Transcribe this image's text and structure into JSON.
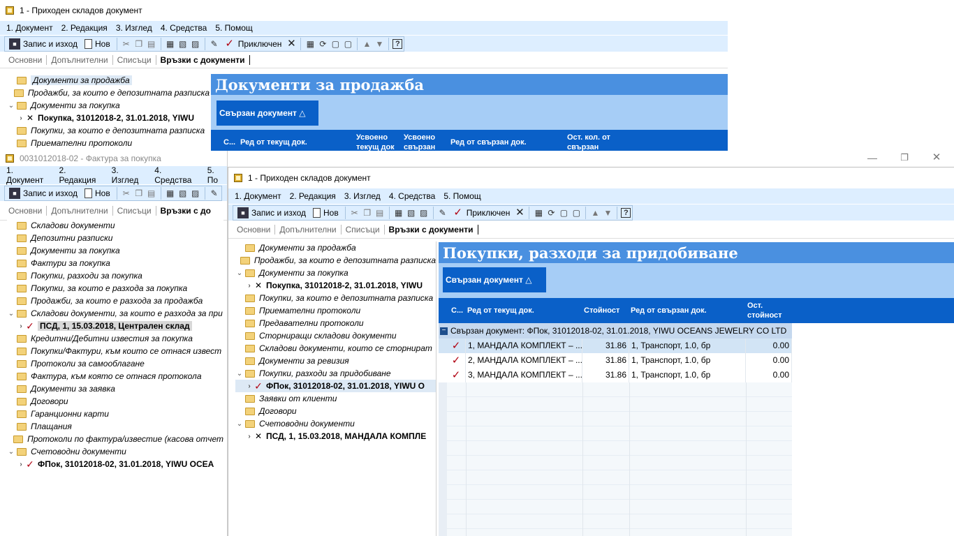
{
  "colors": {
    "menu_bg": "#ddeeff",
    "header_blue": "#4a90e0",
    "grid_head": "#0a60c8",
    "group_area": "#a6cdf6",
    "check_red": "#b00010"
  },
  "back_window": {
    "title": "1 - Приходен складов документ",
    "menu": [
      "1. Документ",
      "2. Редакция",
      "3. Изглед",
      "4. Средства",
      "5. Помощ"
    ],
    "toolbar": {
      "save": "Запис и изход",
      "new": "Нов",
      "closed": "Приключен"
    },
    "tabs": [
      "Основни",
      "Допълнителни",
      "Списъци",
      "Връзки с документи"
    ],
    "tree": [
      "Документи за продажба",
      "Продажби, за които е депозитната разписка",
      "Документи за покупка",
      "Покупка, 31012018-2, 31.01.2018, YIWU",
      "Покупки, за които е депозитната разписка",
      "Приемателни протоколи"
    ],
    "panel_title": "Документи за продажба",
    "group_button": "Свързан документ △",
    "columns": [
      "С...",
      "Ред от текущ док.",
      "Усвоено текущ док",
      "Усвоено свързан",
      "Ред от свързан док.",
      "Ост. кол. от свързан"
    ]
  },
  "middle_window": {
    "title": "0031012018-02 - Фактура за покупка",
    "menu": [
      "1. Документ",
      "2. Редакция",
      "3. Изглед",
      "4. Средства",
      "5. По"
    ],
    "toolbar": {
      "save": "Запис и изход",
      "new": "Нов"
    },
    "tabs": [
      "Основни",
      "Допълнителни",
      "Списъци",
      "Връзки с до"
    ],
    "tree": [
      "Складови документи",
      "Депозитни разписки",
      "Документи за покупка",
      "Фактури за покупка",
      "Покупки, разходи за покупка",
      "Покупки, за които е разхода за покупка",
      "Продажби, за които е разхода за продажба",
      "Складови документи, за които е разхода за при",
      "ПСД, 1, 15.03.2018, Централен склад",
      "Кредитни/Дебитни известия за покупка",
      "Покупки/Фактури, към които се отнася извест",
      "Протоколи за самооблагане",
      "Фактура, към която се отнася протокола",
      "Документи за заявка",
      "Договори",
      "Гаранционни карти",
      "Плащания",
      "Протоколи по фактура/известие (касова отчет",
      "Счетоводни документи",
      "ФПок, 31012018-02, 31.01.2018, YIWU OCEA"
    ]
  },
  "front_window": {
    "title": "1 - Приходен складов документ",
    "menu": [
      "1. Документ",
      "2. Редакция",
      "3. Изглед",
      "4. Средства",
      "5. Помощ"
    ],
    "toolbar": {
      "save": "Запис и изход",
      "new": "Нов",
      "closed": "Приключен"
    },
    "tabs": [
      "Основни",
      "Допълнителни",
      "Списъци",
      "Връзки с документи"
    ],
    "tree": [
      "Документи за продажба",
      "Продажби, за които е депозитната разписка",
      "Документи за покупка",
      "Покупка, 31012018-2, 31.01.2018, YIWU",
      "Покупки, за които е депозитната разписка",
      "Приемателни протоколи",
      "Предавателни протоколи",
      "Сторниращи складови документи",
      "Складови документи, които се сторнират",
      "Документи за ревизия",
      "Покупки, разходи за придобиване",
      "ФПок, 31012018-02, 31.01.2018, YIWU O",
      "Заявки от клиенти",
      "Договори",
      "Счетоводни документи",
      "ПСД, 1, 15.03.2018, МАНДАЛА КОМПЛЕ"
    ],
    "panel_title": "Покупки, разходи за придобиване",
    "group_button": "Свързан документ △",
    "columns": [
      "С...",
      "Ред от текущ док.",
      "Стойност",
      "Ред от свързан док.",
      "Ост. стойност"
    ],
    "group_row": "Свързан документ: ФПок, 31012018-02, 31.01.2018, YIWU OCEANS JEWELRY CO LTD",
    "rows": [
      {
        "line": "1, МАНДАЛА КОМПЛЕКТ – ...",
        "value": "31.86",
        "linked": "1, Транспорт, 1.0, бр",
        "rest": "0.00"
      },
      {
        "line": "2, МАНДАЛА КОМПЛЕКТ – ...",
        "value": "31.86",
        "linked": "1, Транспорт, 1.0, бр",
        "rest": "0.00"
      },
      {
        "line": "3, МАНДАЛА КОМПЛЕКТ – ...",
        "value": "31.86",
        "linked": "1, Транспорт, 1.0, бр",
        "rest": "0.00"
      }
    ]
  }
}
